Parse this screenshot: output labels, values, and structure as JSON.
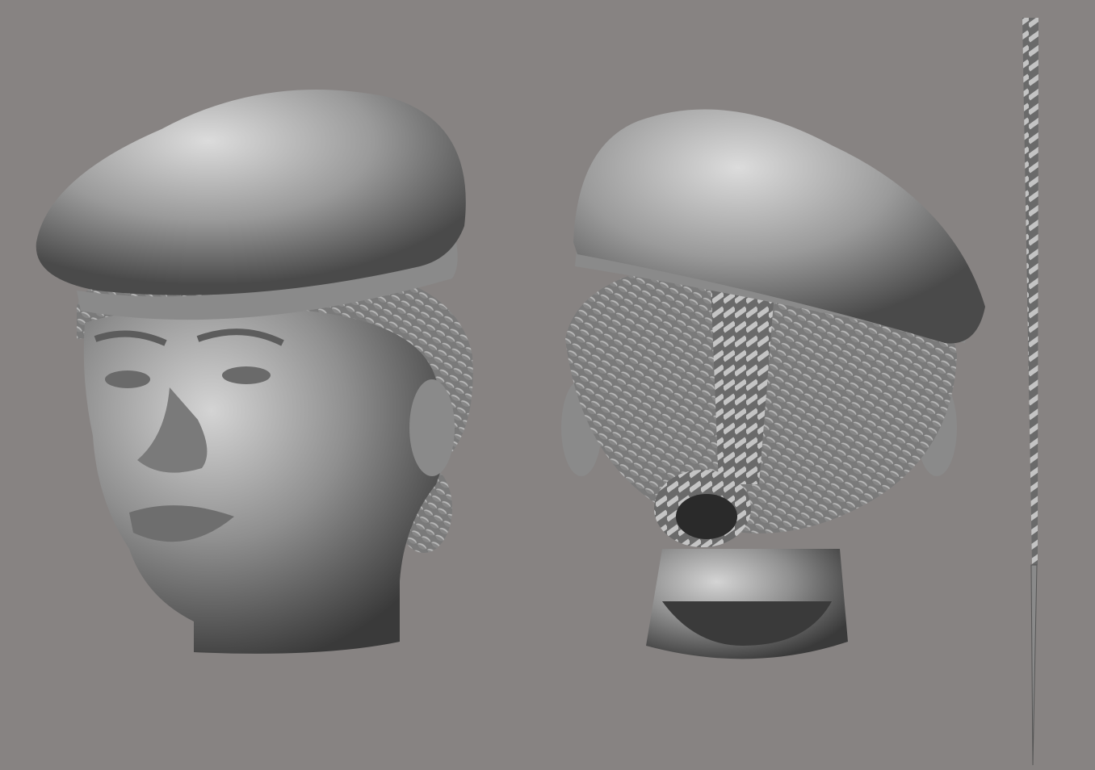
{
  "scene": {
    "background_color": "#878382",
    "clay_color": "#8e8e8e",
    "highlight_color": "#d6d6d6",
    "shadow_color": "#2a2a2a",
    "objects": [
      {
        "name": "front-head-sculpt",
        "icon": "head-front-render"
      },
      {
        "name": "back-head-sculpt",
        "icon": "head-back-render"
      },
      {
        "name": "single-braid-sculpt",
        "icon": "braid-render"
      }
    ]
  }
}
